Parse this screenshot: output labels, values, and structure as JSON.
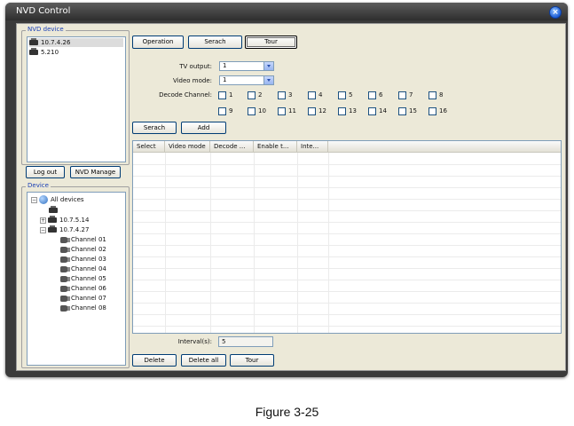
{
  "window": {
    "title": "NVD Control",
    "close_glyph": "×"
  },
  "nvd_device": {
    "label": "NVD device",
    "items": [
      "10.7.4.26",
      "5.210"
    ],
    "logout_label": "Log out",
    "manage_label": "NVD Manage"
  },
  "device": {
    "label": "Device",
    "root": {
      "expander": "−",
      "label": "All devices"
    },
    "child_blank": "",
    "nodes": [
      {
        "expander": "+",
        "label": "10.7.5.14"
      },
      {
        "expander": "−",
        "label": "10.7.4.27"
      }
    ],
    "channels": [
      "Channel 01",
      "Channel 02",
      "Channel 03",
      "Channel 04",
      "Channel 05",
      "Channel 06",
      "Channel 07",
      "Channel 08"
    ]
  },
  "tabs": [
    "Operation",
    "Serach",
    "Tour"
  ],
  "form": {
    "tv_output_label": "TV output:",
    "tv_output_value": "1",
    "video_mode_label": "Video mode:",
    "video_mode_value": "1",
    "decode_channel_label": "Decode Channel:",
    "channels": [
      "1",
      "2",
      "3",
      "4",
      "5",
      "6",
      "7",
      "8",
      "9",
      "10",
      "11",
      "12",
      "13",
      "14",
      "15",
      "16"
    ]
  },
  "actions": {
    "search_label": "Serach",
    "add_label": "Add"
  },
  "grid": {
    "columns": [
      "Select",
      "Video mode",
      "Decode ...",
      "Enable t...",
      "Inte..."
    ]
  },
  "interval": {
    "label": "Interval(s):",
    "value": "5"
  },
  "bottom": {
    "delete_label": "Delete",
    "delete_all_label": "Delete all",
    "tour_label": "Tour"
  },
  "caption": "Figure 3-25"
}
